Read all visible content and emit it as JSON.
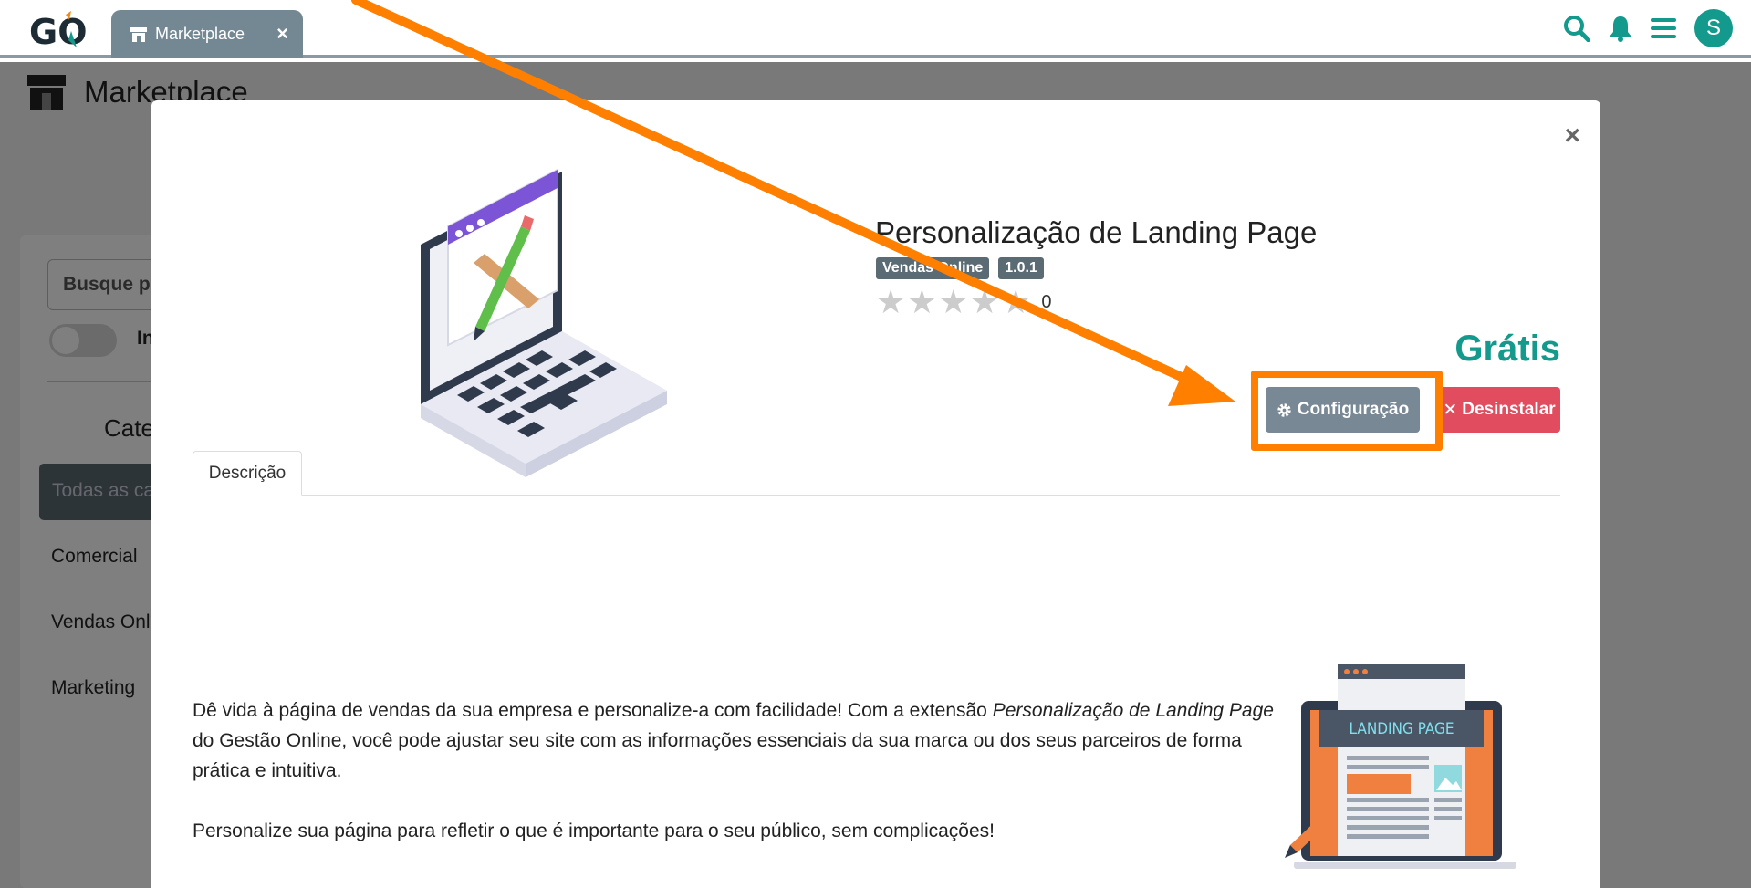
{
  "topbar": {
    "logo_text": "GO",
    "tab_label": "Marketplace",
    "tab_close": "×",
    "avatar_letter": "S"
  },
  "background_page": {
    "title": "Marketplace",
    "search_placeholder": "Busque p",
    "toggle_label": "In",
    "categories_title": "Cate",
    "categories": [
      "Todas as ca",
      "Comercial",
      "Vendas Onl",
      "Marketing"
    ]
  },
  "modal": {
    "close": "×",
    "app_title": "Personalização de Landing Page",
    "badges": [
      "Vendas Online",
      "1.0.1"
    ],
    "rating": {
      "stars": 0,
      "max": 5,
      "count": "0"
    },
    "price": "Grátis",
    "config_button": "Configuração",
    "uninstall_button": "Desinstalar",
    "tab_label": "Descrição",
    "description": {
      "p1_before": "Dê vida à página de vendas da sua empresa e personalize-a com facilidade! Com a extensão ",
      "p1_em": "Personalização de Landing Page",
      "p1_after": " do Gestão Online, você pode ajustar seu site com as informações essenciais da sua marca ou dos seus parceiros de forma prática e intuitiva.",
      "p2": "Personalize sua página para refletir o que é importante para o seu público, sem complicações!"
    },
    "landing_image_text": "LANDING PAGE"
  },
  "colors": {
    "accent": "#139a8c",
    "tab_bg": "#738892",
    "config_btn": "#798895",
    "uninstall_btn": "#e14c5e",
    "annotation": "#ff7f00"
  }
}
